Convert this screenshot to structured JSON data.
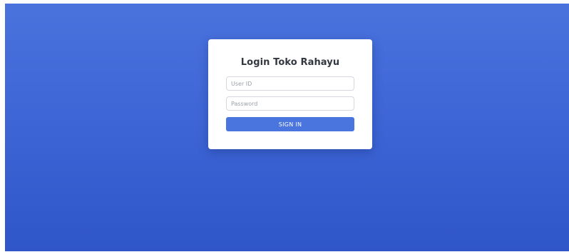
{
  "login": {
    "title": "Login Toko Rahayu",
    "user_id_placeholder": "User ID",
    "user_id_value": "",
    "password_placeholder": "Password",
    "password_value": "",
    "sign_in_label": "SIGN IN"
  },
  "colors": {
    "background_top": "#4a73dd",
    "background_bottom": "#2f56c9",
    "button": "#4a74de",
    "card": "#ffffff"
  }
}
